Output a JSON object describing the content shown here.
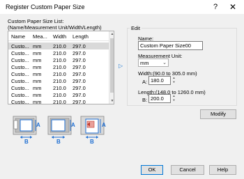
{
  "window": {
    "title": "Register Custom Paper Size",
    "help_glyph": "?",
    "close_glyph": "✕"
  },
  "list": {
    "label_line1": "Custom Paper Size List:",
    "label_line2": "(Name/Measurement Unit/Width/Length)",
    "headers": [
      "Name",
      "Mea...",
      "Width",
      "Length"
    ],
    "rows": [
      [
        "Custo...",
        "mm",
        "210.0",
        "297.0"
      ],
      [
        "Custo...",
        "mm",
        "210.0",
        "297.0"
      ],
      [
        "Custo...",
        "mm",
        "210.0",
        "297.0"
      ],
      [
        "Custo...",
        "mm",
        "210.0",
        "297.0"
      ],
      [
        "Custo...",
        "mm",
        "210.0",
        "297.0"
      ],
      [
        "Custo...",
        "mm",
        "210.0",
        "297.0"
      ],
      [
        "Custo...",
        "mm",
        "210.0",
        "297.0"
      ],
      [
        "Custo...",
        "mm",
        "210.0",
        "297.0"
      ],
      [
        "Custo...",
        "mm",
        "210.0",
        "297.0"
      ]
    ],
    "selected_index": 0
  },
  "diagrams": [
    {
      "labels": [
        "A",
        "B"
      ]
    },
    {
      "labels": [
        "A",
        "B"
      ]
    },
    {
      "labels": [
        "A",
        "B"
      ]
    }
  ],
  "edit": {
    "group_title": "Edit",
    "name_label": "Name:",
    "name_value": "Custom Paper Size00",
    "unit_label": "Measurement Unit:",
    "unit_value": "mm",
    "width_label": "Width:(90.0 to 305.0 mm)",
    "a_label": "A:",
    "a_value": "180.0",
    "length_label": "Length:(148.0 to 1260.0 mm)",
    "b_label": "B:",
    "b_value": "200.0"
  },
  "buttons": {
    "modify": "Modify",
    "ok": "OK",
    "cancel": "Cancel",
    "help": "Help"
  },
  "colors": {
    "accent": "#1e78d2",
    "diagram_blue": "#1e6ed2",
    "diagram_red": "#c0392b"
  }
}
